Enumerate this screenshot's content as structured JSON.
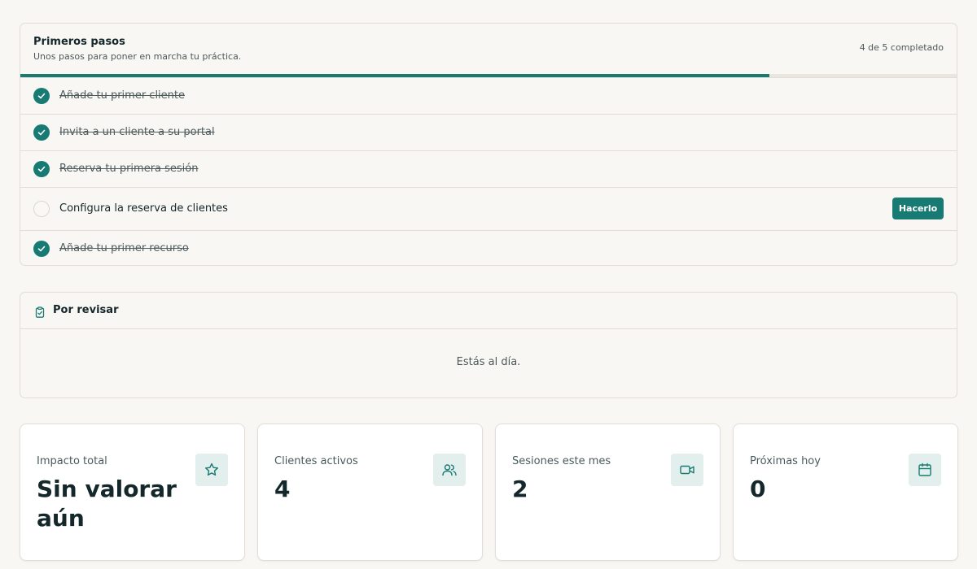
{
  "onboarding": {
    "title": "Primeros pasos",
    "subtitle": "Unos pasos para poner en marcha tu práctica.",
    "progress_text": "4 de 5 completado",
    "progress_fraction": 0.8,
    "steps": [
      {
        "label": "Añade tu primer cliente",
        "done": true
      },
      {
        "label": "Invita a un cliente a su portal",
        "done": true
      },
      {
        "label": "Reserva tu primera sesión",
        "done": true
      },
      {
        "label": "Configura la reserva de clientes",
        "done": false,
        "action_label": "Hacerlo"
      },
      {
        "label": "Añade tu primer recurso",
        "done": true
      }
    ]
  },
  "review": {
    "icon": "clipboard-check-icon",
    "title": "Por revisar",
    "empty_text": "Estás al día."
  },
  "stats": [
    {
      "label": "Impacto total",
      "value": "Sin valorar aún",
      "icon": "star-icon"
    },
    {
      "label": "Clientes activos",
      "value": "4",
      "icon": "users-icon"
    },
    {
      "label": "Sesiones este mes",
      "value": "2",
      "icon": "video-icon"
    },
    {
      "label": "Próximas hoy",
      "value": "0",
      "icon": "calendar-icon"
    }
  ],
  "colors": {
    "accent": "#177a73",
    "background": "#f9f7f3",
    "icon_bg": "#e3efed",
    "border": "#e2ddd6"
  }
}
